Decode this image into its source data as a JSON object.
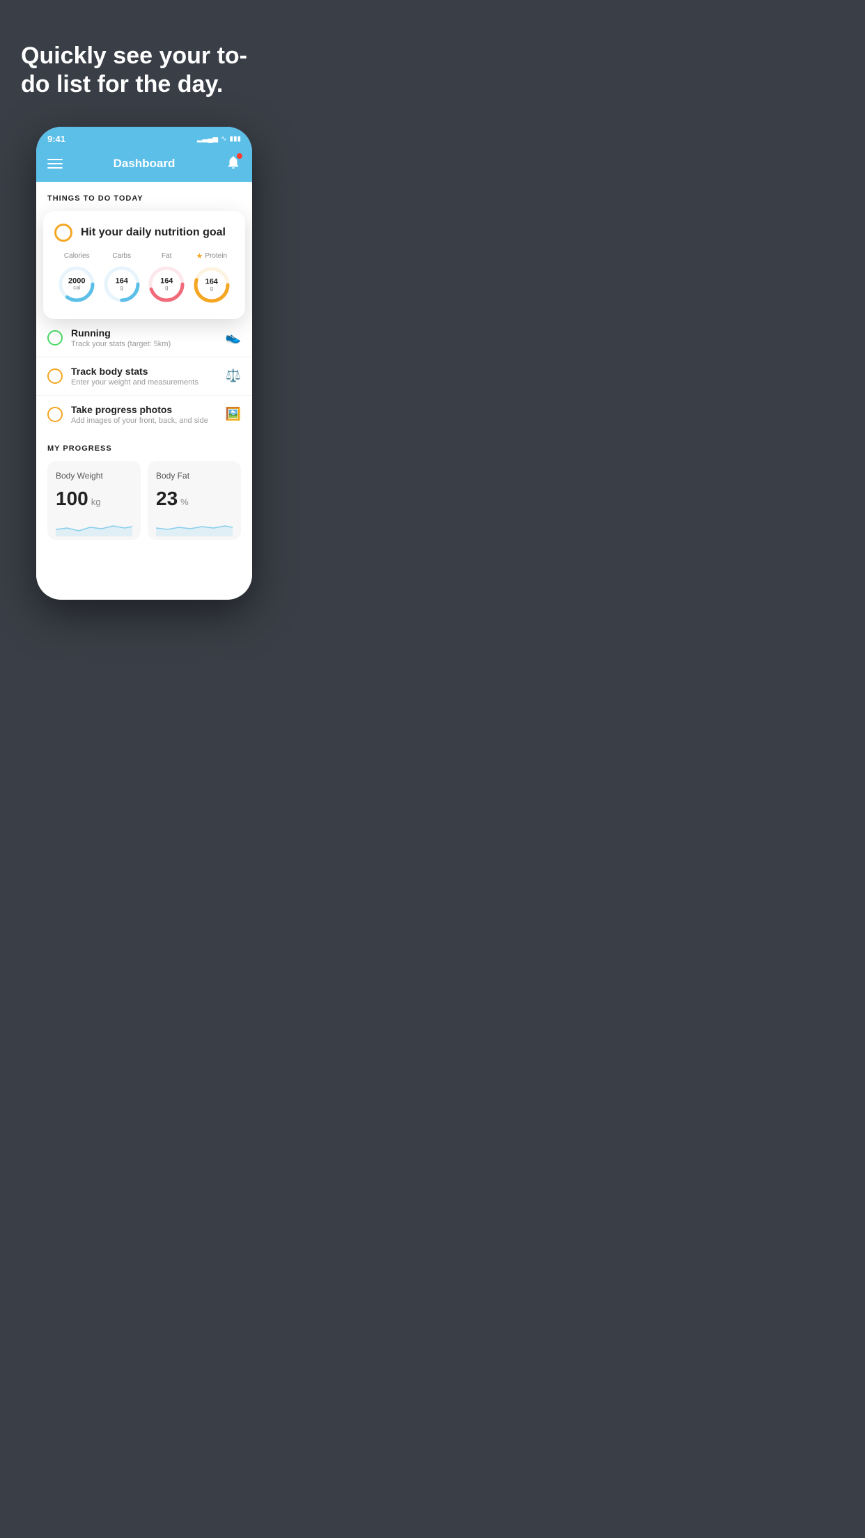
{
  "hero": {
    "title": "Quickly see your to-do list for the day."
  },
  "status_bar": {
    "time": "9:41"
  },
  "nav": {
    "title": "Dashboard"
  },
  "things_today": {
    "header": "THINGS TO DO TODAY"
  },
  "floating_card": {
    "task_title": "Hit your daily nutrition goal",
    "nutrition": [
      {
        "label": "Calories",
        "value": "2000",
        "unit": "cal",
        "color": "#5bbfe8",
        "track_pct": 60,
        "star": false
      },
      {
        "label": "Carbs",
        "value": "164",
        "unit": "g",
        "color": "#5bbfe8",
        "track_pct": 50,
        "star": false
      },
      {
        "label": "Fat",
        "value": "164",
        "unit": "g",
        "color": "#f06a7a",
        "track_pct": 70,
        "star": false
      },
      {
        "label": "Protein",
        "value": "164",
        "unit": "g",
        "color": "#f5a623",
        "track_pct": 80,
        "star": true
      }
    ]
  },
  "todo_items": [
    {
      "title": "Running",
      "subtitle": "Track your stats (target: 5km)",
      "circle_color": "green",
      "icon": "👟"
    },
    {
      "title": "Track body stats",
      "subtitle": "Enter your weight and measurements",
      "circle_color": "yellow",
      "icon": "⚖️"
    },
    {
      "title": "Take progress photos",
      "subtitle": "Add images of your front, back, and side",
      "circle_color": "yellow",
      "icon": "🖼️"
    }
  ],
  "progress": {
    "header": "MY PROGRESS",
    "cards": [
      {
        "label": "Body Weight",
        "value": "100",
        "unit": "kg"
      },
      {
        "label": "Body Fat",
        "value": "23",
        "unit": "%"
      }
    ]
  }
}
